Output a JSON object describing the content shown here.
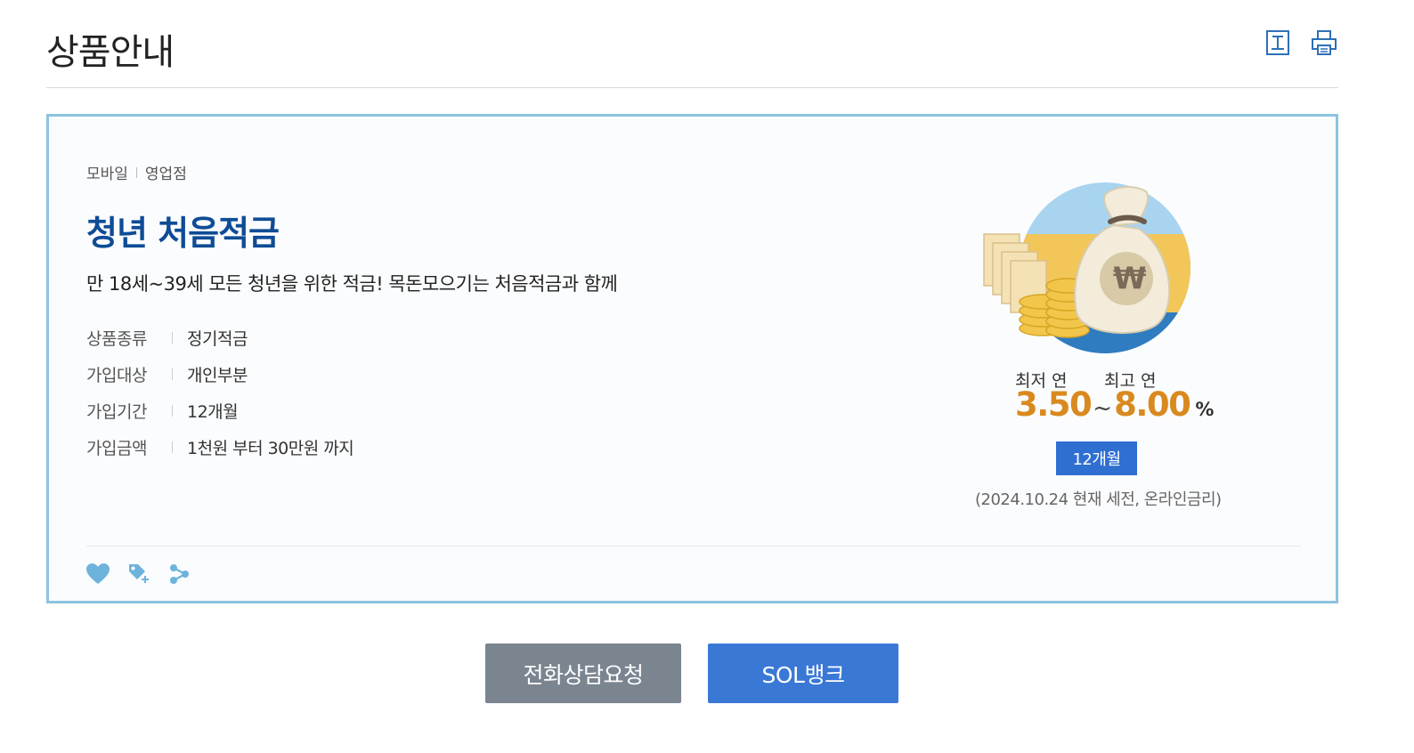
{
  "header": {
    "title": "상품안내"
  },
  "product": {
    "channels": [
      "모바일",
      "영업점"
    ],
    "name": "청년 처음적금",
    "description": "만 18세~39세 모든 청년을 위한 적금! 목돈모으기는 처음적금과 함께",
    "info": [
      {
        "label": "상품종류",
        "value": "정기적금"
      },
      {
        "label": "가입대상",
        "value": "개인부분"
      },
      {
        "label": "가입기간",
        "value": "12개월"
      },
      {
        "label": "가입금액",
        "value": "1천원 부터 30만원 까지"
      }
    ]
  },
  "rate": {
    "min_label": "최저 연",
    "max_label": "최고 연",
    "min_value": "3.50",
    "tilde": "~",
    "max_value": "8.00",
    "unit": "%",
    "term_badge": "12개월",
    "note": "(2024.10.24 현재 세전, 온라인금리)"
  },
  "illustration": {
    "won_symbol": "₩"
  },
  "buttons": {
    "call": "전화상담요청",
    "sol": "SOL뱅크"
  },
  "icons": {
    "font_size": "text-size-icon",
    "print": "print-icon",
    "favorite": "heart-icon",
    "tag": "tag-add-icon",
    "share": "share-icon"
  },
  "colors": {
    "title_blue": "#0e4c96",
    "rate_orange": "#d98a1f",
    "badge_blue": "#2f6fd1",
    "card_border": "#8cc3e0",
    "icon_blue": "#6db3dc",
    "call_gray": "#7b8590",
    "sol_blue": "#3a78d6"
  }
}
